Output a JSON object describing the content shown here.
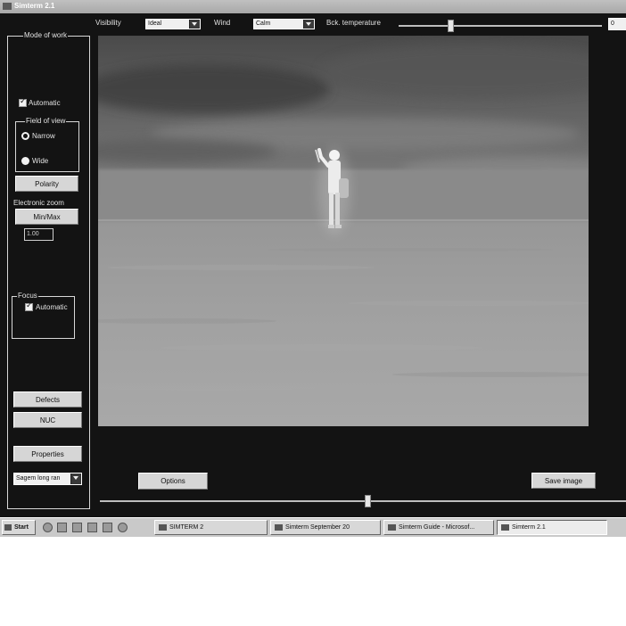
{
  "window": {
    "title": "Simterm 2.1"
  },
  "toolbar": {
    "visibility_label": "Visibility",
    "visibility_value": "Ideal",
    "wind_label": "Wind",
    "wind_value": "Calm",
    "bck_temp_label": "Bck. temperature",
    "bck_temp_value": "0",
    "bck_temp_slider_level": 0.25
  },
  "sidebar": {
    "mode_group_label": "Mode of work",
    "automatic_label": "Automatic",
    "fov_group_label": "Field of view",
    "narrow_label": "Narrow",
    "wide_label": "Wide",
    "fov_selected": "Narrow",
    "polarity_label": "Polarity",
    "ezoom_label": "Electronic zoom",
    "minmax_label": "Min/Max",
    "zoom_value": "1.00",
    "focus_group_label": "Focus",
    "focus_automatic_label": "Automatic",
    "defects_label": "Defects",
    "nuc_label": "NUC",
    "properties_label": "Properties",
    "camera_select": "Sagem long ran"
  },
  "bottom": {
    "options_label": "Options",
    "save_image_label": "Save image",
    "slider_level": 0.51
  },
  "taskbar": {
    "start_label": "Start",
    "tasks": [
      {
        "label": "SIMTERM 2",
        "icon": "folder-icon"
      },
      {
        "label": "Simterm September 20",
        "icon": "folder-icon"
      },
      {
        "label": "Simterm Guide - Microsof...",
        "icon": "document-icon"
      },
      {
        "label": "Simterm 2.1",
        "icon": "app-icon"
      }
    ]
  }
}
